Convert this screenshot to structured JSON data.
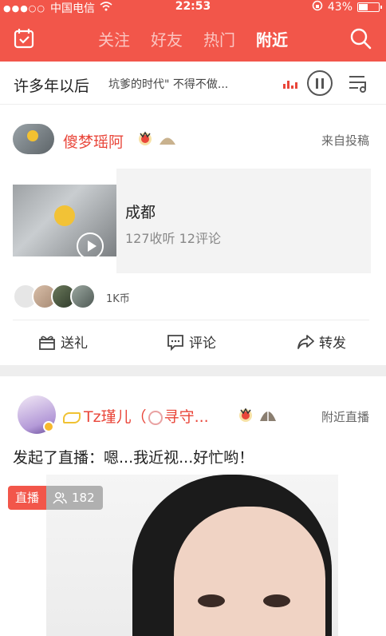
{
  "status_bar": {
    "carrier": "中国电信",
    "time": "22:53",
    "battery": "43%",
    "battery_level": 0.43
  },
  "nav": {
    "tabs": [
      {
        "label": "关注",
        "active": false
      },
      {
        "label": "好友",
        "active": false
      },
      {
        "label": "热门",
        "active": false
      },
      {
        "label": "附近",
        "active": true
      }
    ]
  },
  "player": {
    "song": "许多年以后",
    "marquee": "坑爹的时代\" 不得不做...",
    "state": "playing"
  },
  "post1": {
    "username": "傻梦瑶阿",
    "source": "来自投稿",
    "card_title": "成都",
    "card_meta": "127收听  12评论",
    "coins": "1K币",
    "actions": {
      "gift": "送礼",
      "comment": "评论",
      "share": "转发"
    }
  },
  "post2": {
    "username": "Tz瑾儿（",
    "username_tail": "寻守...",
    "source": "附近直播",
    "description": "发起了直播：嗯...我近视...好忙哟！",
    "live_tag": "直播",
    "viewer_count": "182"
  },
  "colors": {
    "brand_red": "#f2564a",
    "accent_red": "#e9463a"
  }
}
